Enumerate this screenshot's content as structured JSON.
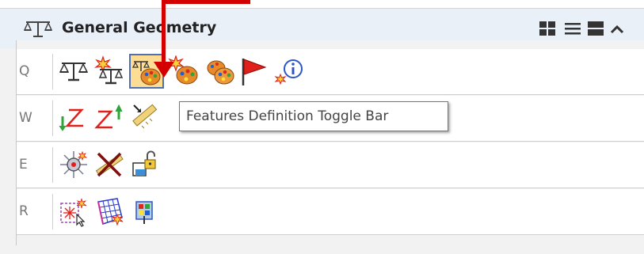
{
  "panel": {
    "title": "General Geometry",
    "header_buttons": [
      "grid-view-icon",
      "list-view-icon",
      "expanded-view-icon",
      "collapse-chevron-icon"
    ]
  },
  "rows": [
    {
      "key": "Q",
      "tools": [
        "balance-scale-icon",
        "balance-scale-star-icon",
        "features-definition-toggle-icon",
        "palette-star-icon",
        "palettes-icon",
        "red-flag-icon",
        "info-icon"
      ]
    },
    {
      "key": "W",
      "tools": [
        "z-line-down-icon",
        "z-line-up-icon",
        "measure-ruler-icon"
      ]
    },
    {
      "key": "E",
      "tools": [
        "target-burst-icon",
        "cross-measure-icon",
        "lock-box-icon"
      ]
    },
    {
      "key": "R",
      "tools": [
        "select-burst-icon",
        "mesh-star-icon",
        "pin-grid-icon"
      ]
    }
  ],
  "tooltip": {
    "text": "Features Definition Toggle Bar"
  },
  "colors": {
    "header_bg": "#eaf0f8",
    "accent_red": "#d40000",
    "selected_bg": "#fddc93",
    "selected_border": "#5070b0"
  }
}
